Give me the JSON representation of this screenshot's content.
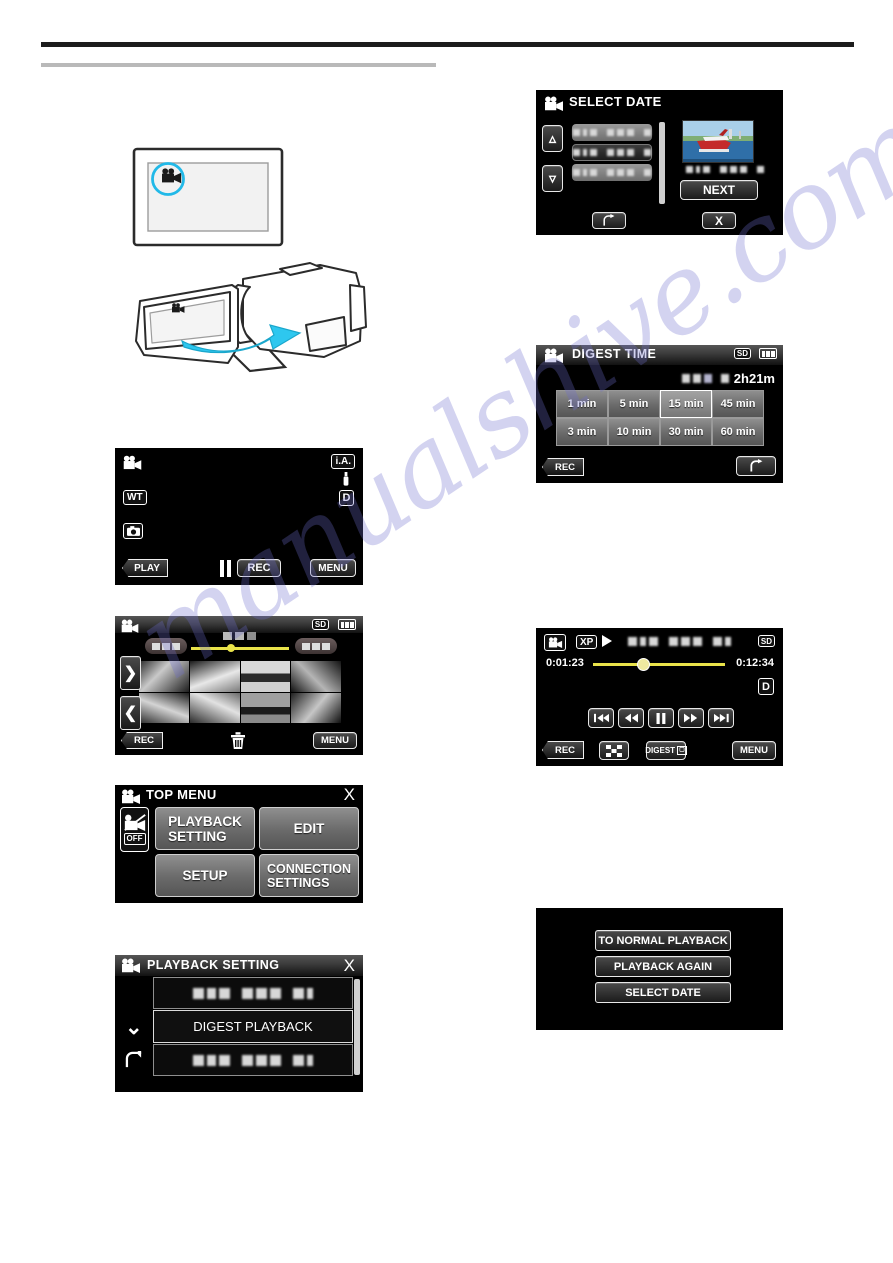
{
  "page": {
    "watermark_text": "manualshive.com",
    "accent_cyan": "#22b9e8",
    "slider_yellow": "#e9e34a"
  },
  "illustration": {
    "name": "camcorder-open-lcd",
    "callout_icon": "video-mode-icon",
    "arrow": "open-lcd-arrow"
  },
  "screens": {
    "record_standby": {
      "name": "record-standby-screen",
      "mode_icon": "video-mode-icon",
      "ia_label": "i.A.",
      "mic_icon": "mic-icon",
      "zoom_label": "WT",
      "display_label": "D",
      "still_icon": "still-capture-icon",
      "play_label": "PLAY",
      "rec_label": "REC",
      "pause_icon": "pause-icon",
      "menu_label": "MENU"
    },
    "thumbnail_index": {
      "name": "thumbnail-index-screen",
      "mode_icon": "video-mode-icon",
      "sd_label": "SD",
      "battery_icon": "battery-icon",
      "next_arrow": "page-forward-arrow",
      "prev_arrow": "page-back-arrow",
      "rec_label": "REC",
      "delete_icon": "trash-icon",
      "menu_label": "MENU",
      "thumbs": [
        "plant-thumb",
        "person-thumb",
        "boat-thumb",
        "leaves-thumb",
        "flower-thumb",
        "deckchair-thumb",
        "sunset-thumb",
        "bamboo-thumb"
      ]
    },
    "top_menu": {
      "name": "top-menu-screen",
      "title": "TOP MENU",
      "close_label": "X",
      "silent_icon": "silent-mode-off-icon",
      "silent_state": "OFF",
      "items": [
        {
          "label": "PLAYBACK\nSETTING",
          "icon": "film-icon"
        },
        {
          "label": "EDIT",
          "icon": "scissors-icon"
        },
        {
          "label": "SETUP",
          "icon": "gear-icon"
        },
        {
          "label": "CONNECTION\nSETTINGS",
          "icon": "connection-icon"
        }
      ]
    },
    "playback_setting": {
      "name": "playback-setting-screen",
      "title": "PLAYBACK SETTING",
      "close_label": "X",
      "down_icon": "chevron-down-icon",
      "back_icon": "return-arrow-icon",
      "rows": [
        {
          "label": "",
          "redacted": true
        },
        {
          "label": "DIGEST PLAYBACK",
          "redacted": false
        },
        {
          "label": "",
          "redacted": true
        }
      ]
    },
    "select_date": {
      "name": "select-date-screen",
      "title": "SELECT DATE",
      "up_icon": "chevron-up-icon",
      "down_icon": "chevron-down-icon",
      "back_icon": "return-arrow-icon",
      "close_label": "X",
      "next_label": "NEXT",
      "thumbnail": "seaplane-thumb",
      "date_rows": [
        "",
        "",
        ""
      ]
    },
    "digest_time": {
      "name": "digest-time-screen",
      "title": "DIGEST TIME",
      "sd_label": "SD",
      "battery_icon": "battery-icon",
      "total_time": "2h21m",
      "rec_label": "REC",
      "back_icon": "return-arrow-icon",
      "options_row1": [
        "1 min",
        "5 min",
        "15 min",
        "45 min"
      ],
      "options_row2": [
        "3 min",
        "10 min",
        "30 min",
        "60 min"
      ],
      "selected": "15 min"
    },
    "playback": {
      "name": "video-playback-screen",
      "mode_icon": "video-mode-icon",
      "quality_label": "XP",
      "play_icon": "play-icon",
      "sd_label": "SD",
      "elapsed": "0:01:23",
      "total": "0:12:34",
      "display_label": "D",
      "transport": [
        "skip-back-icon",
        "rewind-icon",
        "pause-icon",
        "fast-forward-icon",
        "skip-forward-icon"
      ],
      "rec_label": "REC",
      "index_icon": "index-grid-icon",
      "digest_label": "DIGEST",
      "menu_label": "MENU"
    },
    "digest_end_menu": {
      "name": "digest-end-menu-screen",
      "items": [
        "TO NORMAL PLAYBACK",
        "PLAYBACK AGAIN",
        "SELECT DATE"
      ]
    }
  }
}
